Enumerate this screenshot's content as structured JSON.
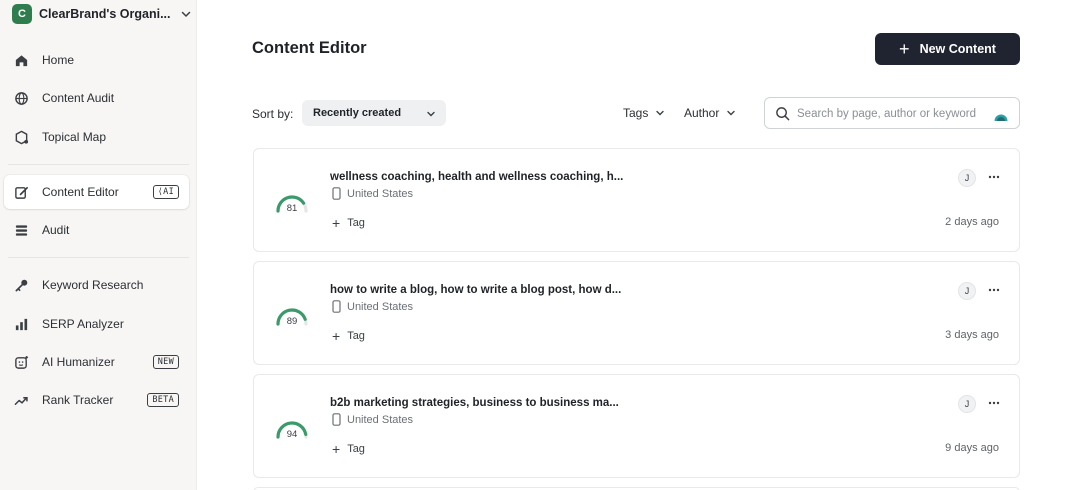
{
  "org": {
    "initial": "C",
    "name": "ClearBrand's Organi...",
    "brand_color": "#2f7d4f"
  },
  "sidebar": {
    "items": [
      {
        "label": "Home",
        "icon": "home-icon"
      },
      {
        "label": "Content Audit",
        "icon": "globe-icon"
      },
      {
        "label": "Topical Map",
        "icon": "map-icon"
      },
      {
        "label": "Content Editor",
        "icon": "edit-icon",
        "badge": "AI",
        "active": true
      },
      {
        "label": "Audit",
        "icon": "list-icon"
      },
      {
        "label": "Keyword Research",
        "icon": "key-icon"
      },
      {
        "label": "SERP Analyzer",
        "icon": "bar-chart-icon"
      },
      {
        "label": "AI Humanizer",
        "icon": "face-icon",
        "badge": "NEW"
      },
      {
        "label": "Rank Tracker",
        "icon": "trend-icon",
        "badge": "BETA"
      }
    ]
  },
  "header": {
    "title": "Content Editor",
    "new_button": "New Content"
  },
  "toolbar": {
    "sort_label": "Sort by:",
    "sort_value": "Recently created",
    "tags_label": "Tags",
    "author_label": "Author",
    "search_placeholder": "Search by page, author or keyword"
  },
  "cards": [
    {
      "title": "wellness coaching, health and wellness coaching, h...",
      "location": "United States",
      "tag": "Tag",
      "date": "2 days ago",
      "score": "81",
      "score_value": 81,
      "author": "J"
    },
    {
      "title": "how to write a blog, how to write a blog post, how d...",
      "location": "United States",
      "tag": "Tag",
      "date": "3 days ago",
      "score": "89",
      "score_value": 89,
      "author": "J"
    },
    {
      "title": "b2b marketing strategies, business to business ma...",
      "location": "United States",
      "tag": "Tag",
      "date": "9 days ago",
      "score": "94",
      "score_value": 94,
      "author": "J"
    }
  ],
  "colors": {
    "accent": "#1f2430",
    "gauge_good": "#3a9a6a",
    "gauge_track": "#e4e6e8"
  }
}
